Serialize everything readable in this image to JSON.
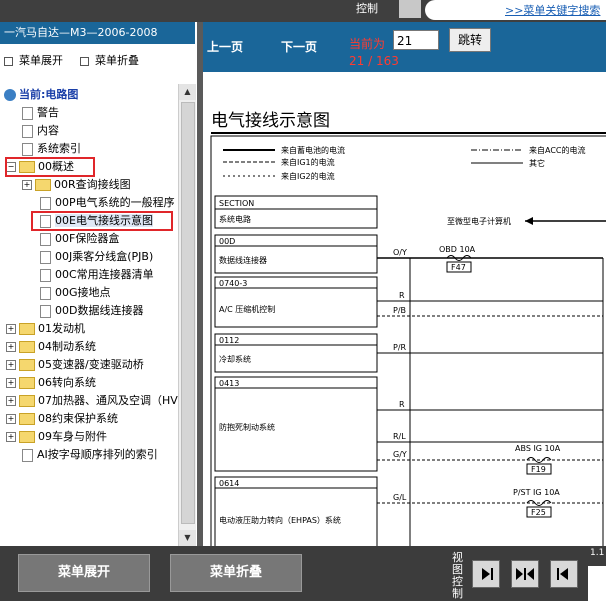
{
  "top": {
    "control_label": "控制",
    "keyword_link": ">>菜单关键字搜索"
  },
  "left": {
    "title": "一汽马自达—M3—2006-2008",
    "expand_label": "菜单展开",
    "collapse_label": "菜单折叠",
    "tree": [
      {
        "label": "当前:电路图",
        "level": 0,
        "kind": "current"
      },
      {
        "label": "警告",
        "level": 1,
        "kind": "doc"
      },
      {
        "label": "内容",
        "level": 1,
        "kind": "doc"
      },
      {
        "label": "系统索引",
        "level": 1,
        "kind": "doc"
      },
      {
        "label": "00概述",
        "level": 0,
        "kind": "folder-open"
      },
      {
        "label": "00R查询接线图",
        "level": 1,
        "kind": "folder"
      },
      {
        "label": "00P电气系统的一般程序",
        "level": 2,
        "kind": "doc"
      },
      {
        "label": "00E电气接线示意图",
        "level": 2,
        "kind": "doc",
        "selected": true
      },
      {
        "label": "00F保险器盒",
        "level": 2,
        "kind": "doc"
      },
      {
        "label": "00J乘客分线盒(PJB)",
        "level": 2,
        "kind": "doc"
      },
      {
        "label": "00C常用连接器清单",
        "level": 2,
        "kind": "doc"
      },
      {
        "label": "00G接地点",
        "level": 2,
        "kind": "doc"
      },
      {
        "label": "00D数据线连接器",
        "level": 2,
        "kind": "doc"
      },
      {
        "label": "01发动机",
        "level": 0,
        "kind": "folder"
      },
      {
        "label": "04制动系统",
        "level": 0,
        "kind": "folder"
      },
      {
        "label": "05变速器/变速驱动桥",
        "level": 0,
        "kind": "folder"
      },
      {
        "label": "06转向系统",
        "level": 0,
        "kind": "folder"
      },
      {
        "label": "07加热器、通风及空调（HV",
        "level": 0,
        "kind": "folder"
      },
      {
        "label": "08约束保护系统",
        "level": 0,
        "kind": "folder"
      },
      {
        "label": "09车身与附件",
        "level": 0,
        "kind": "folder"
      },
      {
        "label": "AI按字母顺序排列的索引",
        "level": 1,
        "kind": "doc"
      }
    ]
  },
  "nav": {
    "prev": "上一页",
    "next": "下一页",
    "current_label": "当前为",
    "page_value": "21",
    "jump": "跳转",
    "page_count": "21 / 163"
  },
  "content": {
    "title": "电气接线示意图",
    "legend": {
      "battery": "来自蓄电池的电流",
      "ig1": "来自IG1的电流",
      "ig2": "来自IG2的电流",
      "acc": "来自ACC的电流",
      "other": "其它"
    },
    "ecu_label": "至微型电子计算机",
    "sections": [
      {
        "code": "SECTION",
        "name": "系统电路"
      },
      {
        "code": "00D",
        "name": "数据线连接器"
      },
      {
        "code": "0740-3",
        "name": "A/C 压缩机控制"
      },
      {
        "code": "0112",
        "name": "冷却系统"
      },
      {
        "code": "0413",
        "name": "防抱死制动系统"
      },
      {
        "code": "0614",
        "name": "电动液压助力转向（EHPAS）系统"
      }
    ],
    "wires": [
      "O/Y",
      "R",
      "P/B",
      "P/R",
      "R",
      "R/L",
      "G/Y",
      "G/L"
    ],
    "fuses": [
      {
        "name": "OBD 10A",
        "id": "F47"
      },
      {
        "name": "ABS IG 10A",
        "id": "F19"
      },
      {
        "name": "P/ST IG 10A",
        "id": "F25"
      }
    ]
  },
  "bottom": {
    "expand": "菜单展开",
    "collapse": "菜单折叠",
    "view_control": "视图控制",
    "corner": "1.1"
  }
}
